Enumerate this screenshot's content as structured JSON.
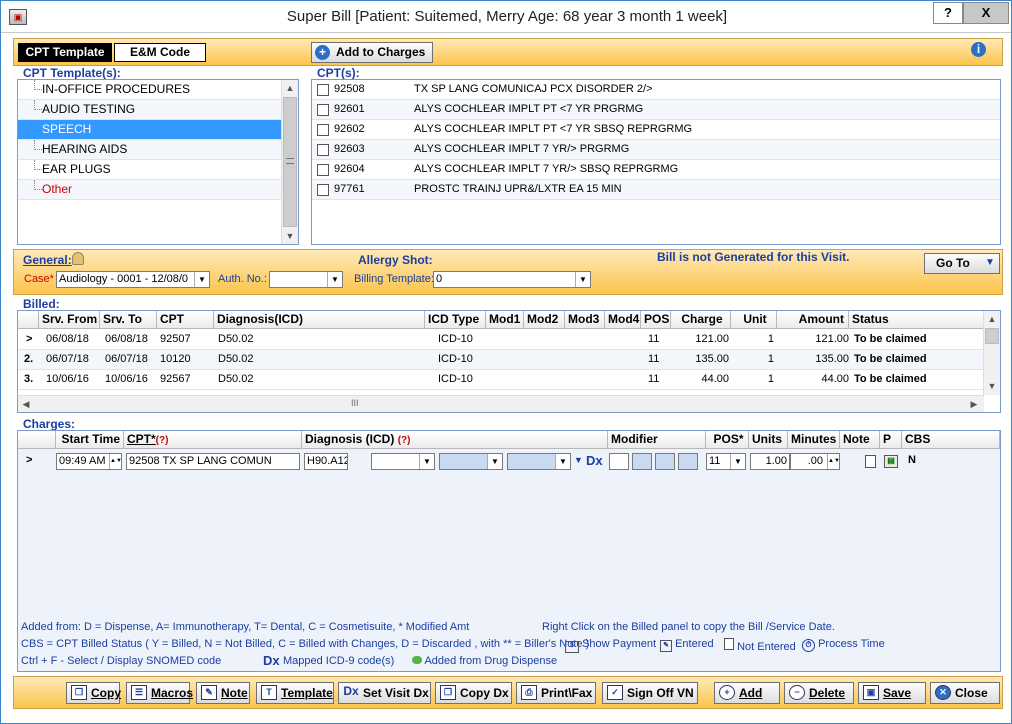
{
  "window": {
    "title": "Super Bill  [Patient: Suitemed, Merry   Age: 68 year 3 month 1 week]",
    "help": "?",
    "close": "X"
  },
  "topbar": {
    "tab_cpt": "CPT Template",
    "tab_em": "E&M Code",
    "add_to_charges": "Add to Charges"
  },
  "cpt_templates": {
    "label": "CPT Template(s):",
    "items": [
      {
        "label": "IN-OFFICE PROCEDURES"
      },
      {
        "label": "AUDIO TESTING"
      },
      {
        "label": "SPEECH"
      },
      {
        "label": "HEARING AIDS"
      },
      {
        "label": "EAR PLUGS"
      },
      {
        "label": "Other"
      }
    ]
  },
  "cpts": {
    "label": "CPT(s):",
    "items": [
      {
        "code": "92508",
        "desc": "TX SP LANG COMUNICAJ PCX DISORDER 2/>"
      },
      {
        "code": "92601",
        "desc": "ALYS COCHLEAR IMPLT PT <7 YR PRGRMG"
      },
      {
        "code": "92602",
        "desc": "ALYS COCHLEAR IMPLT PT <7 YR SBSQ REPRGRMG"
      },
      {
        "code": "92603",
        "desc": "ALYS COCHLEAR IMPLT 7 YR/> PRGRMG"
      },
      {
        "code": "92604",
        "desc": "ALYS COCHLEAR IMPLT 7 YR/> SBSQ REPRGRMG"
      },
      {
        "code": "97761",
        "desc": "PROSTC TRAINJ UPR&/LXTR EA 15 MIN"
      }
    ]
  },
  "general": {
    "label": "General:",
    "case_label": "Case*",
    "case_value": "Audiology  - 0001 - 12/08/0",
    "auth_label": "Auth. No.:",
    "auth_value": "",
    "allergy_label": "Allergy Shot:",
    "billing_template_label": "Billing Template:",
    "billing_template_value": "0",
    "bill_status": "Bill is not Generated for this Visit.",
    "goto": "Go To"
  },
  "billed": {
    "label": "Billed:",
    "headers": [
      "Srv. From",
      "Srv. To",
      "CPT",
      "Diagnosis(ICD)",
      "ICD Type",
      "Mod1",
      "Mod2",
      "Mod3",
      "Mod4",
      "POS",
      "Charge",
      "Unit",
      "Amount",
      "Status"
    ],
    "rows": [
      {
        "idx": ">",
        "from": "06/08/18",
        "to": "06/08/18",
        "cpt": "92507",
        "dx": "D50.02",
        "icd": "ICD-10",
        "pos": "11",
        "charge": "121.00",
        "unit": "1",
        "amount": "121.00",
        "status": "To be claimed"
      },
      {
        "idx": "2.",
        "from": "06/07/18",
        "to": "06/07/18",
        "cpt": "10120",
        "dx": "D50.02",
        "icd": "ICD-10",
        "pos": "11",
        "charge": "135.00",
        "unit": "1",
        "amount": "135.00",
        "status": "To be claimed"
      },
      {
        "idx": "3.",
        "from": "10/06/16",
        "to": "10/06/16",
        "cpt": "92567",
        "dx": "D50.02",
        "icd": "ICD-10",
        "pos": "11",
        "charge": "44.00",
        "unit": "1",
        "amount": "44.00",
        "status": "To be claimed"
      }
    ],
    "scroll_mark": "III"
  },
  "charges": {
    "label": "Charges:",
    "headers": [
      "Start Time",
      "CPT*",
      "Diagnosis (ICD)",
      "Modifier",
      "POS*",
      "Units",
      "Minutes",
      "Note",
      "P",
      "CBS"
    ],
    "req_mark": "(?)",
    "row": {
      "idx": ">",
      "time": "09:49 AM",
      "cpt": "92508     TX SP LANG COMUN",
      "dx": "H90.A12",
      "pos": "11",
      "units": "1.00",
      "minutes": ".00",
      "cbs": "N",
      "dx_icon": "Dx"
    }
  },
  "legend": {
    "added_from": "Added from: D = Dispense, A= Immunotherapy, T= Dental,  C = Cosmetisuite,   * Modified Amt",
    "right_click": "Right Click on the Billed panel to copy the Bill /Service Date.",
    "cbs": "CBS = CPT Billed Status ( Y = Billed, N = Not Billed, C = Billed with Changes, D = Discarded , with ** = Biller's Note )",
    "show_payment": "Show Payment",
    "entered": "Entered",
    "not_entered": "Not Entered",
    "process_time": "Process Time",
    "ctrl_f": "Ctrl + F - Select / Display SNOMED code",
    "dx": "Dx",
    "mapped": "Mapped ICD-9 code(s)",
    "drug": "Added from Drug Dispense"
  },
  "bottom": {
    "copy": "Copy",
    "macros": "Macros",
    "note": "Note",
    "template": "Template",
    "set_visit_dx": "Set Visit Dx",
    "copy_dx": "Copy Dx",
    "print_fax": "Print\\Fax",
    "sign_off": "Sign Off VN",
    "add": "Add",
    "delete": "Delete",
    "save": "Save",
    "close": "Close"
  },
  "colors": {
    "accent": "#1b3ea0",
    "selected": "#3399ff",
    "orange": "#fbc44b"
  }
}
